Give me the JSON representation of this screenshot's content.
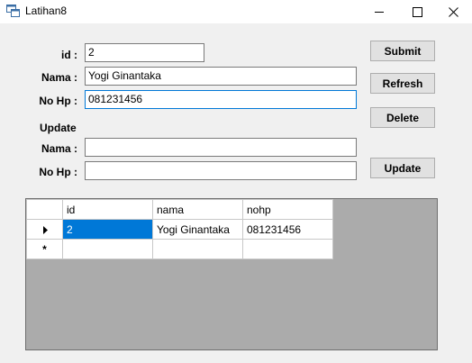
{
  "window": {
    "title": "Latihan8"
  },
  "form": {
    "id_label": "id :",
    "id_value": "2",
    "nama_label": "Nama :",
    "nama_value": "Yogi Ginantaka",
    "nohp_label": "No Hp :",
    "nohp_value": "081231456",
    "update_header": "Update",
    "update_nama_label": "Nama :",
    "update_nama_value": "",
    "update_nohp_label": "No Hp :",
    "update_nohp_value": ""
  },
  "buttons": {
    "submit": "Submit",
    "refresh": "Refresh",
    "delete": "Delete",
    "update": "Update"
  },
  "grid": {
    "columns": [
      "id",
      "nama",
      "nohp"
    ],
    "rows": [
      {
        "indicator": "current",
        "id": "2",
        "nama": "Yogi Ginantaka",
        "nohp": "081231456"
      }
    ],
    "new_row_marker": "*"
  },
  "colors": {
    "selection": "#0078d7",
    "grid_background": "#ababab"
  }
}
